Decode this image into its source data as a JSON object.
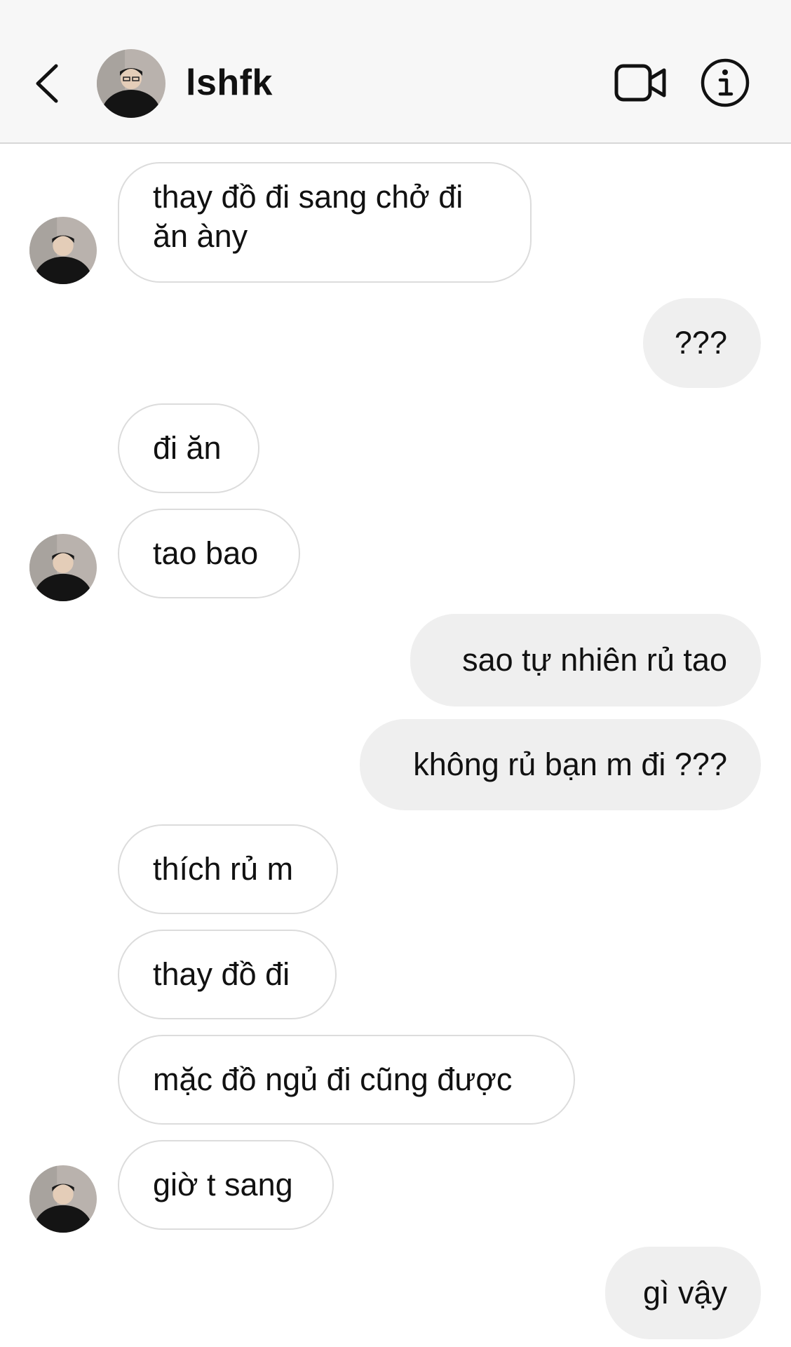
{
  "header": {
    "contact_name": "lshfk",
    "back_icon": "chevron-left-icon",
    "video_icon": "video-camera-icon",
    "info_icon": "info-icon"
  },
  "messages": [
    {
      "side": "in",
      "text": "thay đồ đi sang chở đi ăn àny",
      "avatar": true
    },
    {
      "side": "out",
      "text": "???"
    },
    {
      "side": "in",
      "text": "đi ăn"
    },
    {
      "side": "in",
      "text": "tao bao",
      "avatar": true
    },
    {
      "side": "out",
      "text": "sao tự nhiên rủ tao"
    },
    {
      "side": "out",
      "text": "không rủ bạn m đi ???"
    },
    {
      "side": "in",
      "text": "thích rủ m"
    },
    {
      "side": "in",
      "text": "thay đồ đi"
    },
    {
      "side": "in",
      "text": "mặc đồ ngủ đi cũng được"
    },
    {
      "side": "in",
      "text": "giờ t sang",
      "avatar": true
    },
    {
      "side": "out",
      "text": "gì vậy"
    }
  ],
  "colors": {
    "header_bg": "#f7f7f7",
    "incoming_border": "#dcdcdc",
    "outgoing_bg": "#efefef",
    "text": "#111111"
  }
}
